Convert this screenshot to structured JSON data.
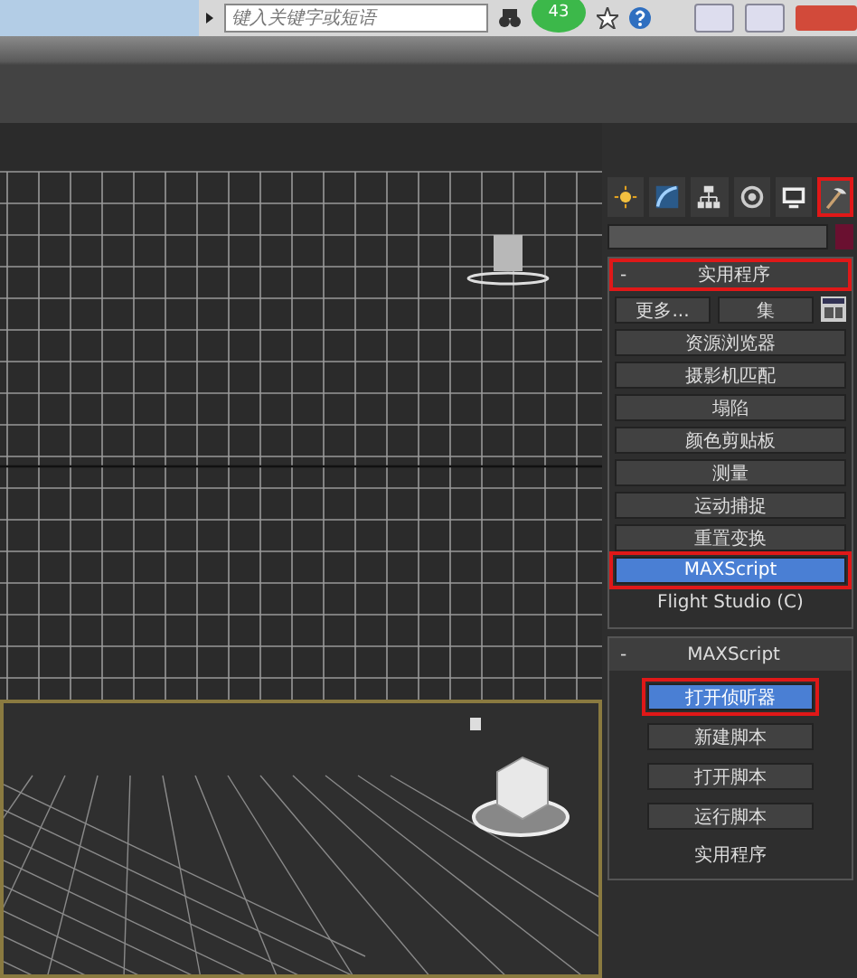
{
  "title_bar": {
    "search": {
      "placeholder": "键入关键字或短语"
    },
    "badge": "43"
  },
  "command_panel": {
    "tabs": [
      {
        "kind": "create",
        "selected": false
      },
      {
        "kind": "modify",
        "selected": false
      },
      {
        "kind": "hierarchy",
        "selected": false
      },
      {
        "kind": "motion",
        "selected": false
      },
      {
        "kind": "display",
        "selected": false
      },
      {
        "kind": "utilities",
        "selected": true
      }
    ],
    "rollouts": [
      {
        "title": "实用程序",
        "toggle": "-",
        "highlighted": true,
        "tool_row": [
          "更多...",
          "集"
        ],
        "items": [
          {
            "label": "资源浏览器",
            "selected": false
          },
          {
            "label": "摄影机匹配",
            "selected": false
          },
          {
            "label": "塌陷",
            "selected": false
          },
          {
            "label": "颜色剪贴板",
            "selected": false
          },
          {
            "label": "测量",
            "selected": false
          },
          {
            "label": "运动捕捉",
            "selected": false
          },
          {
            "label": "重置变换",
            "selected": false
          },
          {
            "label": "MAXScript",
            "selected": true
          },
          {
            "label": "Flight Studio (C)",
            "selected": false,
            "kind": "plain"
          }
        ]
      },
      {
        "title": "MAXScript",
        "toggle": "-",
        "highlighted": false,
        "items": [
          {
            "label": "打开侦听器",
            "selected": true,
            "kind": "narrow"
          },
          {
            "label": "新建脚本",
            "selected": false,
            "kind": "narrow"
          },
          {
            "label": "打开脚本",
            "selected": false,
            "kind": "narrow"
          },
          {
            "label": "运行脚本",
            "selected": false,
            "kind": "narrow"
          },
          {
            "label": "实用程序",
            "kind": "caption"
          }
        ]
      }
    ]
  }
}
